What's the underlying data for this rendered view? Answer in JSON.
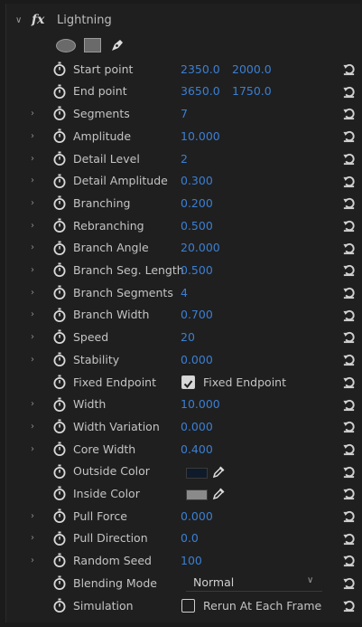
{
  "effect": {
    "title": "Lightning",
    "fx_label": "fx"
  },
  "tools": [
    {
      "icon": "ellipse-mask-icon"
    },
    {
      "icon": "rectangle-mask-icon"
    },
    {
      "icon": "pen-mask-icon"
    }
  ],
  "properties": [
    {
      "label": "Start point",
      "kind": "point",
      "x": "2350.0",
      "y": "2000.0",
      "expandable": false
    },
    {
      "label": "End point",
      "kind": "point",
      "x": "3650.0",
      "y": "1750.0",
      "expandable": false
    },
    {
      "label": "Segments",
      "kind": "value",
      "value": "7",
      "expandable": true
    },
    {
      "label": "Amplitude",
      "kind": "value",
      "value": "10.000",
      "expandable": true
    },
    {
      "label": "Detail Level",
      "kind": "value",
      "value": "2",
      "expandable": true
    },
    {
      "label": "Detail Amplitude",
      "kind": "value",
      "value": "0.300",
      "expandable": true
    },
    {
      "label": "Branching",
      "kind": "value",
      "value": "0.200",
      "expandable": true
    },
    {
      "label": "Rebranching",
      "kind": "value",
      "value": "0.500",
      "expandable": true
    },
    {
      "label": "Branch Angle",
      "kind": "value",
      "value": "20.000",
      "expandable": true
    },
    {
      "label": "Branch Seg. Length",
      "kind": "value",
      "value": "0.500",
      "expandable": true
    },
    {
      "label": "Branch Segments",
      "kind": "value",
      "value": "4",
      "expandable": true
    },
    {
      "label": "Branch Width",
      "kind": "value",
      "value": "0.700",
      "expandable": true
    },
    {
      "label": "Speed",
      "kind": "value",
      "value": "20",
      "expandable": true
    },
    {
      "label": "Stability",
      "kind": "value",
      "value": "0.000",
      "expandable": true
    },
    {
      "label": "Fixed Endpoint",
      "kind": "checkbox",
      "checked": true,
      "text": "Fixed Endpoint",
      "expandable": false
    },
    {
      "label": "Width",
      "kind": "value",
      "value": "10.000",
      "expandable": true
    },
    {
      "label": "Width Variation",
      "kind": "value",
      "value": "0.000",
      "expandable": true
    },
    {
      "label": "Core Width",
      "kind": "value",
      "value": "0.400",
      "expandable": true
    },
    {
      "label": "Outside Color",
      "kind": "color",
      "color": "#0f1a2a",
      "expandable": false
    },
    {
      "label": "Inside Color",
      "kind": "color",
      "color": "#8a8a8a",
      "expandable": false
    },
    {
      "label": "Pull Force",
      "kind": "value",
      "value": "0.000",
      "expandable": true
    },
    {
      "label": "Pull Direction",
      "kind": "value",
      "value": "0.0",
      "expandable": true
    },
    {
      "label": "Random Seed",
      "kind": "value",
      "value": "100",
      "expandable": true
    },
    {
      "label": "Blending Mode",
      "kind": "dropdown",
      "value": "Normal",
      "expandable": false
    },
    {
      "label": "Simulation",
      "kind": "checkbox",
      "checked": false,
      "text": "Rerun At Each Frame",
      "expandable": false
    }
  ],
  "colors": {
    "value_blue": "#3b7fd3",
    "panel_bg": "#1f1f1f"
  }
}
